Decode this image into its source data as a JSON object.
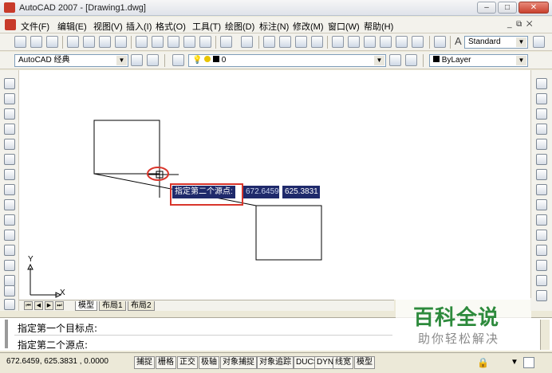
{
  "window": {
    "title": "AutoCAD 2007 - [Drawing1.dwg]"
  },
  "menu": [
    "文件(F)",
    "编辑(E)",
    "视图(V)",
    "插入(I)",
    "格式(O)",
    "工具(T)",
    "绘图(D)",
    "标注(N)",
    "修改(M)",
    "窗口(W)",
    "帮助(H)"
  ],
  "toolbar": {
    "textstyle": "Standard",
    "workspace": "AutoCAD 经典",
    "layer": "0",
    "color": "ByLayer"
  },
  "prompt": {
    "label": "指定第二个源点:",
    "x_value": "672.6459",
    "y_value": "625.3831"
  },
  "ucs": {
    "x_label": "X",
    "y_label": "Y"
  },
  "tabs": [
    "模型",
    "布局1",
    "布局2"
  ],
  "command": {
    "line1": "指定第一个目标点:",
    "line2": "指定第二个源点:"
  },
  "status": {
    "coords": "672.6459,  625.3831 , 0.0000",
    "buttons": [
      "捕捉",
      "栅格",
      "正交",
      "极轴",
      "对象捕捉",
      "对象追踪",
      "DUCS",
      "DYN",
      "线宽",
      "模型"
    ]
  },
  "watermark": {
    "title": "百科全说",
    "subtitle": "助你轻松解决"
  },
  "colors": {
    "highlight": "#d9352b",
    "tip_bg": "#1f2a6b",
    "watermark_green": "#2d8a3c"
  }
}
